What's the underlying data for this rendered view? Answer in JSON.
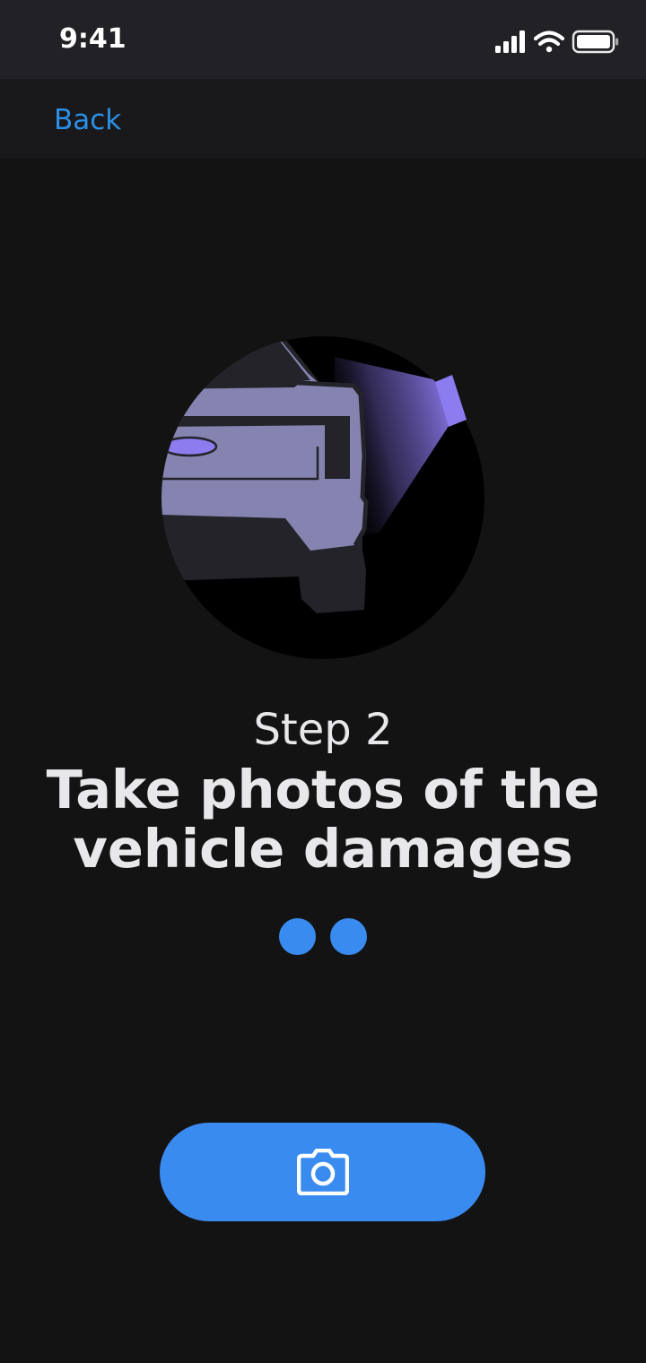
{
  "status_bar": {
    "time": "9:41",
    "icons": [
      "signal-icon",
      "wifi-icon",
      "battery-icon"
    ]
  },
  "nav": {
    "back_label": "Back"
  },
  "content": {
    "illustration_icon": "car-damage-scan-illustration",
    "step_label": "Step 2",
    "title": "Take photos of the vehicle damages",
    "page_dots": 2
  },
  "actions": {
    "camera_button_icon": "camera-icon"
  },
  "colors": {
    "background": "#131314",
    "status_bar": "#222226",
    "nav_bar": "#19191b",
    "accent": "#3a8bef",
    "link": "#2b8fe6",
    "text": "#e8e8ea",
    "illustration_car": "#8583b0",
    "illustration_light": "#8d7bf0"
  }
}
